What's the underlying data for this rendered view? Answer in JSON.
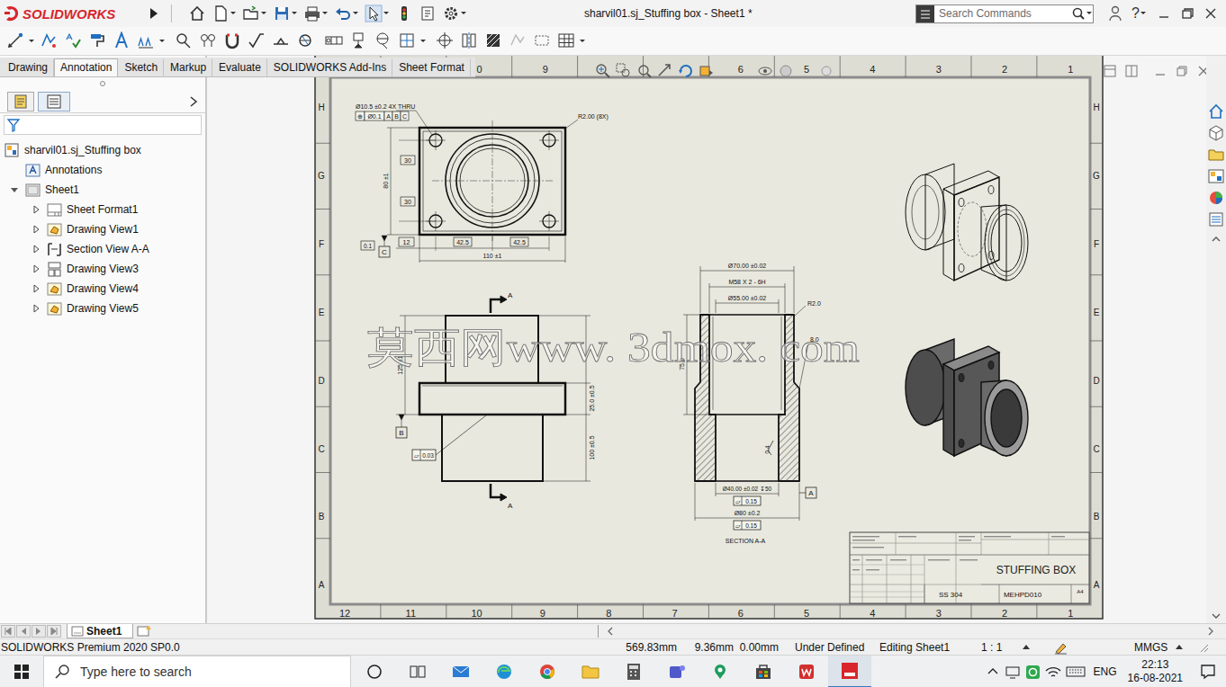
{
  "window": {
    "logo": "SOLIDWORKS",
    "title": "sharvil01.sj_Stuffing box - Sheet1 *",
    "help": "?"
  },
  "search": {
    "placeholder": "Search Commands"
  },
  "tabs": [
    {
      "label": "Drawing",
      "selected": false
    },
    {
      "label": "Annotation",
      "selected": true
    },
    {
      "label": "Sketch",
      "selected": false
    },
    {
      "label": "Markup",
      "selected": false
    },
    {
      "label": "Evaluate",
      "selected": false
    },
    {
      "label": "SOLIDWORKS Add-Ins",
      "selected": false
    },
    {
      "label": "Sheet Format",
      "selected": false
    }
  ],
  "feature_tree": {
    "root": "sharvil01.sj_Stuffing box",
    "items": [
      {
        "label": "Annotations",
        "kind": "annotations",
        "expandable": false,
        "expanded": false
      },
      {
        "label": "Sheet1",
        "kind": "sheet",
        "expandable": true,
        "expanded": true,
        "children": [
          {
            "label": "Sheet Format1",
            "kind": "format",
            "expandable": true,
            "expanded": false
          },
          {
            "label": "Drawing View1",
            "kind": "view",
            "expandable": true,
            "expanded": false
          },
          {
            "label": "Section View A-A",
            "kind": "section",
            "expandable": true,
            "expanded": false
          },
          {
            "label": "Drawing View3",
            "kind": "projected",
            "expandable": true,
            "expanded": false
          },
          {
            "label": "Drawing View4",
            "kind": "view",
            "expandable": true,
            "expanded": false
          },
          {
            "label": "Drawing View5",
            "kind": "view",
            "expandable": true,
            "expanded": false
          }
        ]
      }
    ]
  },
  "sheet": {
    "zones_top_left": [
      "0",
      "9"
    ],
    "zones_top_right": [
      "6",
      "5",
      "4",
      "3",
      "2",
      "1"
    ],
    "zones_bottom": [
      "12",
      "11",
      "10",
      "9",
      "8",
      "7",
      "6",
      "5",
      "4",
      "3",
      "2",
      "1"
    ],
    "zones_side": [
      "H",
      "G",
      "F",
      "E",
      "D",
      "C",
      "B",
      "A"
    ]
  },
  "top_view": {
    "hole_note": "Ø10.5 ±0.2 4X THRU",
    "frame": [
      "⊕",
      "Ø0.1",
      "A",
      "B",
      "C"
    ],
    "radius_note": "R2.00 (8X)",
    "v_upper": "30",
    "v_total": "80 ±1",
    "v_lower": "30",
    "h_edge": "12",
    "h_left": "42.5",
    "h_right": "42.5",
    "h_total": "110 ±1",
    "datum": "C",
    "datum_tol": "0.1"
  },
  "front_view": {
    "cut_top": "A",
    "cut_bottom": "A",
    "h_left": "125 ±1",
    "h_flange": "25.0 ±0.5",
    "h_lower": "100 ±0.5",
    "datum": "B",
    "flatness": [
      "▱",
      "0.03"
    ]
  },
  "section_view": {
    "d_outer": "Ø70.00 ±0.02",
    "thread": "M58 X 2 - 6H",
    "d_inner": "Ø55.00 ±0.02",
    "radius": "R2.0",
    "depth": "75.0",
    "chamfer": "8.0",
    "roughness": "0.4",
    "d_bore": "Ø40.00 ±0.02 ↧50",
    "bore_flatness": [
      "▱",
      "0.15"
    ],
    "d_base": "Ø80 ±0.2",
    "base_flatness": [
      "▱",
      "0.15"
    ],
    "datum": "A",
    "label": "SECTION A-A"
  },
  "title_block": {
    "title": "STUFFING BOX",
    "material": "SS 304",
    "number": "MEHPD010",
    "size": "A4"
  },
  "watermark": "莫西网www. 3dmox. com",
  "sheet_tabs": [
    {
      "label": "Sheet1",
      "selected": true
    }
  ],
  "status_bar": {
    "product": "SOLIDWORKS Premium 2020 SP0.0",
    "x": "569.83mm",
    "y": "9.36mm",
    "z": "0.00mm",
    "state": "Under Defined",
    "mode": "Editing Sheet1",
    "scale": "1 : 1",
    "units": "MMGS"
  },
  "taskbar": {
    "search_placeholder": "Type here to search",
    "language": "ENG",
    "time": "22:13",
    "date": "16-08-2021"
  }
}
